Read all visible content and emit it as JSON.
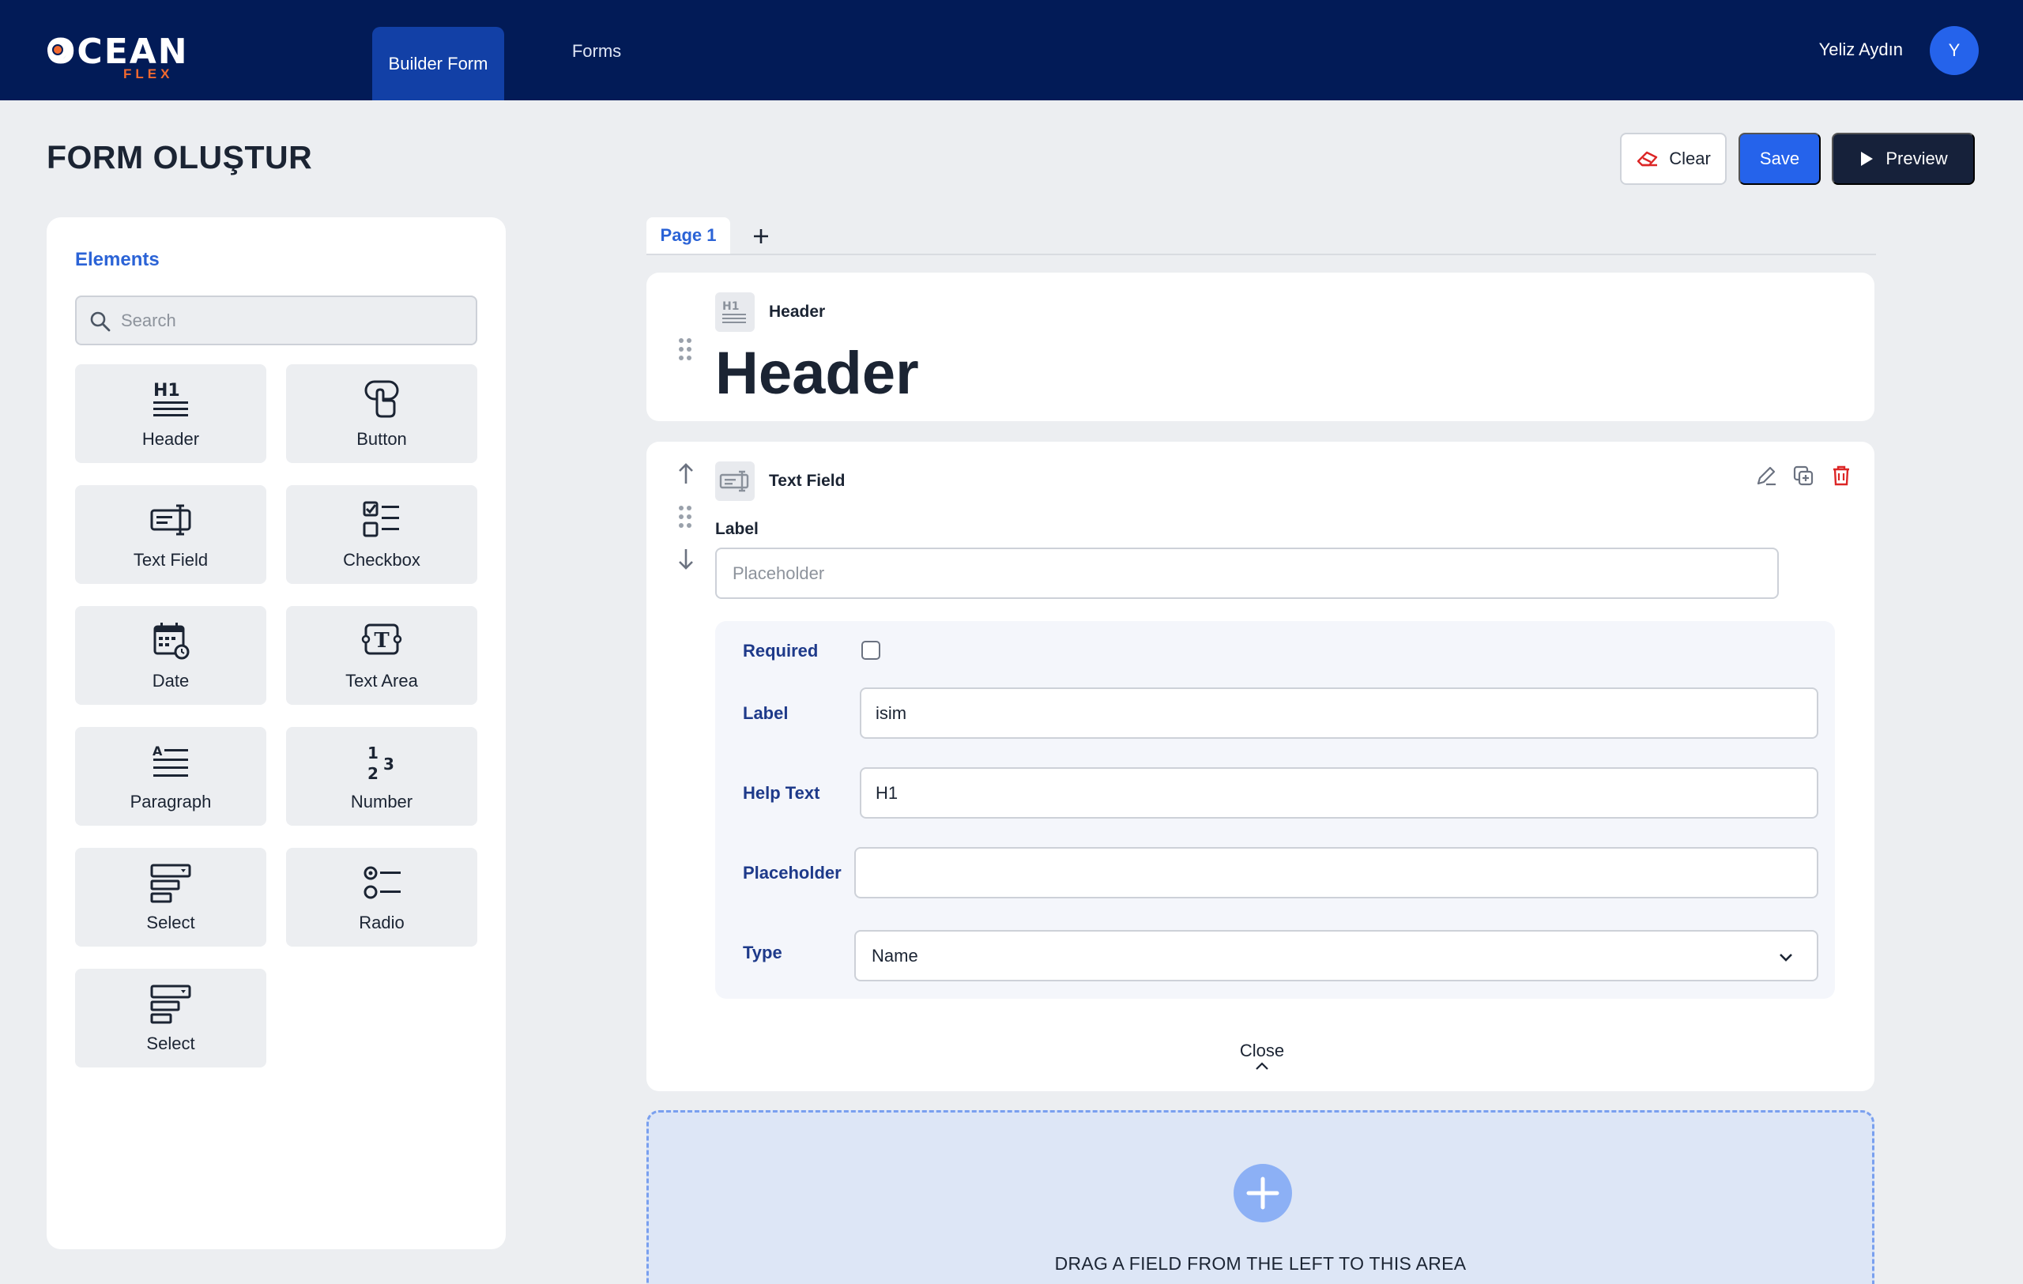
{
  "nav": {
    "logo_main": "OCEAN",
    "logo_sub": "FLEX",
    "tabs": [
      {
        "label": "Builder Form",
        "active": true
      },
      {
        "label": "Forms",
        "active": false
      }
    ],
    "user_name": "Yeliz Aydın",
    "avatar_initial": "Y"
  },
  "page": {
    "title": "FORM OLUŞTUR",
    "actions": {
      "clear_label": "Clear",
      "save_label": "Save",
      "preview_label": "Preview"
    }
  },
  "sidebar": {
    "title": "Elements",
    "search_placeholder": "Search",
    "elements": [
      {
        "label": "Header",
        "icon": "h1-icon"
      },
      {
        "label": "Button",
        "icon": "pointer-icon"
      },
      {
        "label": "Text Field",
        "icon": "text-field-icon"
      },
      {
        "label": "Checkbox",
        "icon": "checkbox-list-icon"
      },
      {
        "label": "Date",
        "icon": "calendar-icon"
      },
      {
        "label": "Text Area",
        "icon": "text-area-icon"
      },
      {
        "label": "Paragraph",
        "icon": "paragraph-icon"
      },
      {
        "label": "Number",
        "icon": "number-icon"
      },
      {
        "label": "Select",
        "icon": "select-icon"
      },
      {
        "label": "Radio",
        "icon": "radio-list-icon"
      },
      {
        "label": "Select",
        "icon": "select-icon"
      }
    ]
  },
  "canvas": {
    "page_tab": "Page 1",
    "header_block": {
      "type_label": "Header",
      "content": "Header"
    },
    "text_field_block": {
      "type_label": "Text Field",
      "field_label": "Label",
      "field_placeholder": "Placeholder",
      "props": {
        "required_label": "Required",
        "required_checked": false,
        "label_label": "Label",
        "label_value": "isim",
        "help_label": "Help Text",
        "help_value": "H1",
        "placeholder_label": "Placeholder",
        "placeholder_value": "",
        "type_label": "Type",
        "type_value": "Name"
      },
      "close_label": "Close"
    },
    "dropzone_text": "DRAG A FIELD FROM THE LEFT TO THIS AREA"
  },
  "colors": {
    "navbar": "#021b57",
    "accent": "#2563eb",
    "logo_accent": "#f2692f",
    "danger": "#dc2626",
    "dark_button": "#16213a"
  }
}
